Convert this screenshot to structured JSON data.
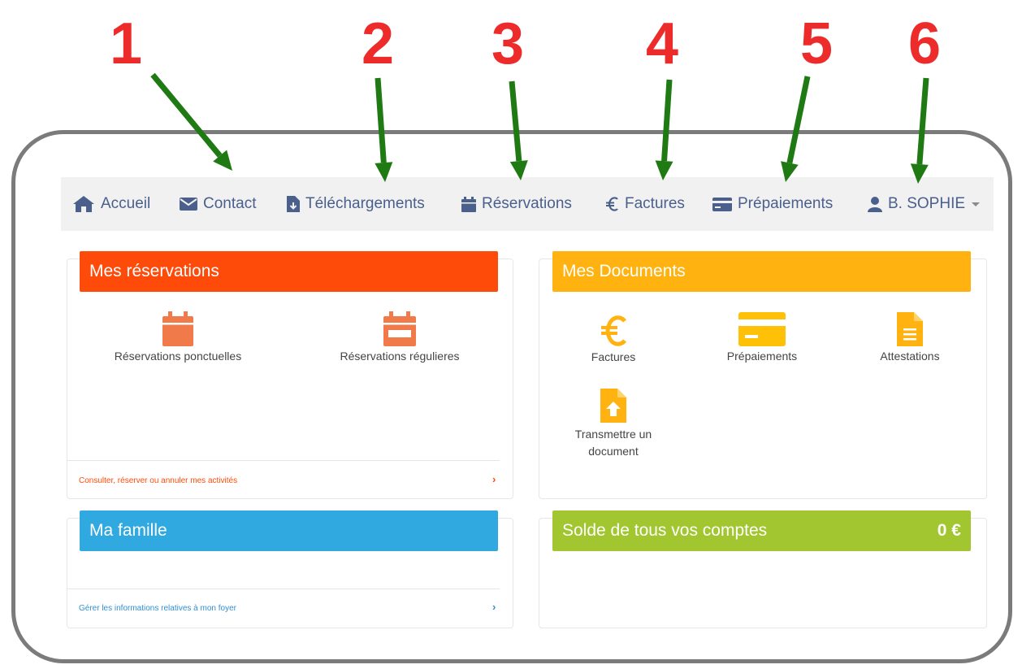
{
  "annotations": {
    "numbers": [
      "1",
      "2",
      "3",
      "4",
      "5",
      "6"
    ],
    "number_color": "#ee2b2b",
    "arrow_color": "#1f7a14"
  },
  "nav": {
    "items": [
      {
        "label": "Accueil",
        "icon": "home-icon"
      },
      {
        "label": "Contact",
        "icon": "envelope-icon"
      },
      {
        "label": "Téléchargements",
        "icon": "download-file-icon"
      },
      {
        "label": "Réservations",
        "icon": "calendar-icon"
      },
      {
        "label": "Factures",
        "icon": "euro-icon"
      },
      {
        "label": "Prépaiements",
        "icon": "credit-card-icon"
      }
    ],
    "user": {
      "label": "B. SOPHIE",
      "icon": "user-icon"
    },
    "link_color": "#4a5f8c"
  },
  "reservations": {
    "title": "Mes réservations",
    "color": "#ff4b0a",
    "tiles": [
      {
        "label": "Réservations ponctuelles",
        "icon": "calendar-icon"
      },
      {
        "label": "Réservations régulieres",
        "icon": "calendar-week-icon"
      }
    ],
    "footer_link": "Consulter, réserver ou annuler mes activités",
    "footer_color": "#ff4b0a"
  },
  "documents": {
    "title": "Mes Documents",
    "color": "#ffb210",
    "tiles": [
      {
        "label": "Factures",
        "icon": "euro-icon"
      },
      {
        "label": "Prépaiements",
        "icon": "credit-card-icon"
      },
      {
        "label": "Attestations",
        "icon": "file-text-icon"
      },
      {
        "label": "Transmettre un document",
        "icon": "file-upload-icon"
      }
    ]
  },
  "famille": {
    "title": "Ma famille",
    "color": "#30a9e0",
    "footer_link": "Gérer les informations relatives à mon foyer",
    "footer_color": "#2f8fd6"
  },
  "solde": {
    "title": "Solde de tous vos comptes",
    "amount": "0 €",
    "color": "#a2c630"
  }
}
